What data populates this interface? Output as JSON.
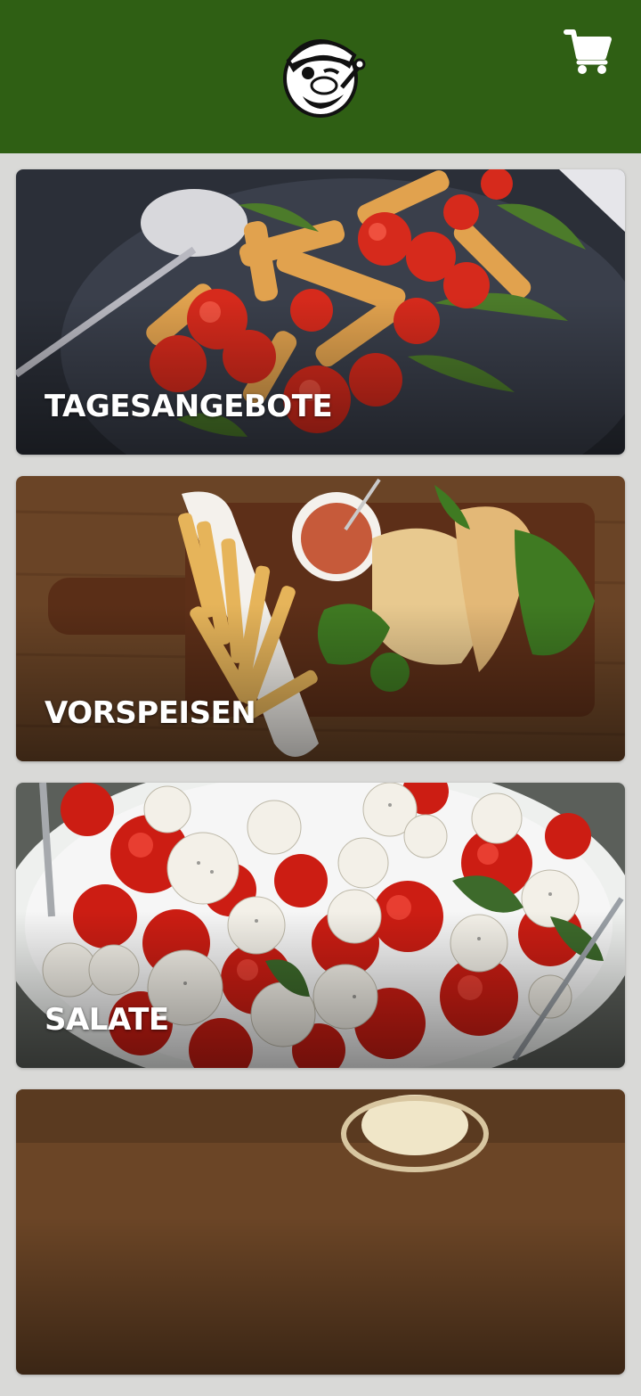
{
  "header": {
    "logo_icon": "sailor-logo-icon",
    "cart_icon": "shopping-cart-icon",
    "background_color": "#2f5f14"
  },
  "categories": [
    {
      "label": "TAGESANGEBOTE"
    },
    {
      "label": "VORSPEISEN"
    },
    {
      "label": "SALATE"
    },
    {
      "label": ""
    }
  ]
}
